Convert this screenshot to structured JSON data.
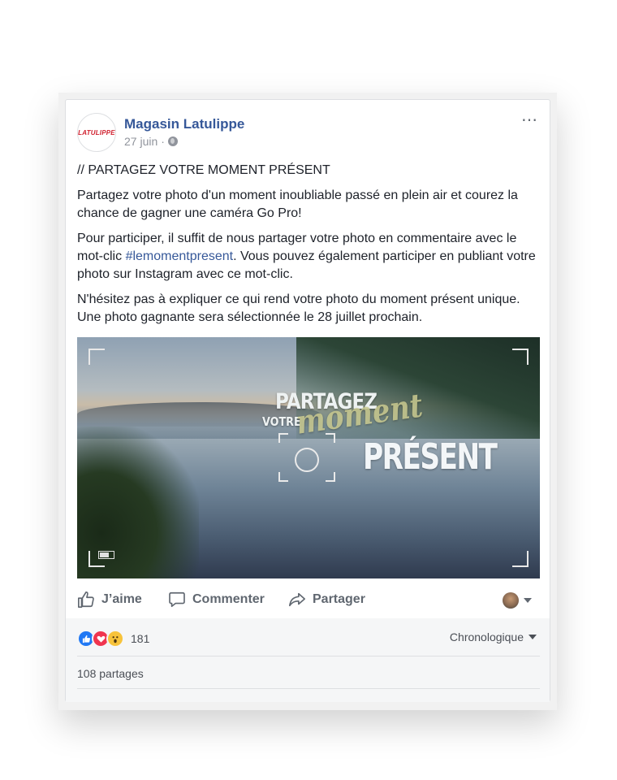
{
  "post": {
    "page_name": "Magasin Latulippe",
    "avatar_logo_text": "LATULIPPE",
    "date": "27 juin",
    "more_icon": "⋯"
  },
  "body": {
    "headline": "// PARTAGEZ VOTRE MOMENT PRÉSENT",
    "p1": "Partagez votre photo d'un moment inoubliable passé en plein air et courez la chance de gagner une caméra Go Pro!",
    "p2_before": "Pour participer, il suffit de nous partager votre photo en commentaire avec le mot-clic ",
    "hashtag": "#lemomentpresent",
    "p2_after": ". Vous pouvez également participer en publiant votre photo sur Instagram avec ce mot-clic.",
    "p3": "N'hésitez pas à expliquer ce qui rend votre photo du moment présent unique. Une photo gagnante sera sélectionnée le 28 juillet prochain."
  },
  "image_overlay": {
    "line1": "PARTAGEZ",
    "line2": "VOTRE",
    "line3": "moment",
    "line4": "PRÉSENT"
  },
  "actions": {
    "like_label": "J’aime",
    "comment_label": "Commenter",
    "share_label": "Partager"
  },
  "stats": {
    "reaction_count": "181",
    "sort_label": "Chronologique",
    "shares_label": "108 partages"
  },
  "colors": {
    "link": "#365899",
    "like_blue": "#2078f4",
    "love_red": "#f0354f",
    "wow_yellow": "#f7c33b"
  }
}
